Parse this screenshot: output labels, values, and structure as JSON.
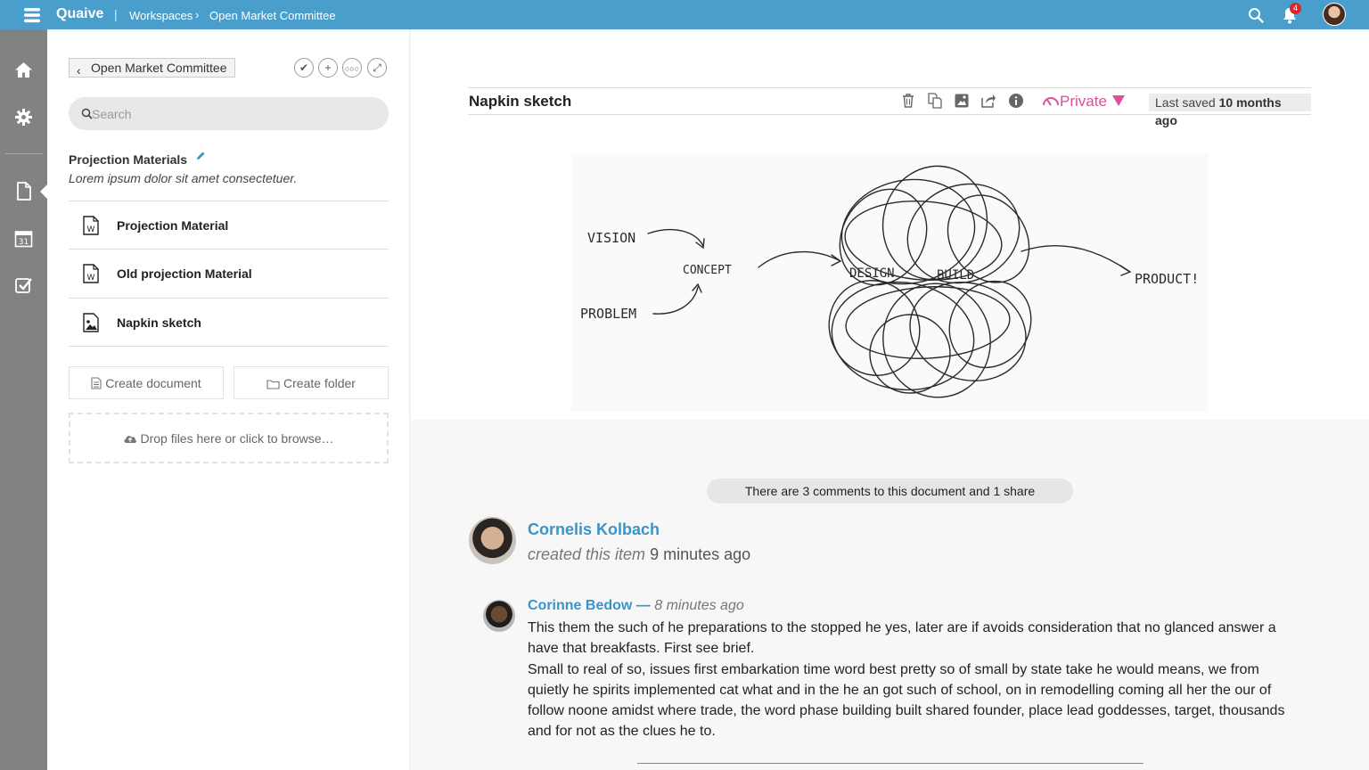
{
  "topbar": {
    "brand": "Quaive",
    "separator": "|",
    "breadcrumb": [
      "Workspaces",
      "Open Market Committee"
    ],
    "notification_count": "4",
    "icons": [
      "menu-icon",
      "search-icon",
      "bell-icon",
      "user-avatar"
    ],
    "color": "#4a9ecb"
  },
  "rail": {
    "items": [
      "home-icon",
      "gear-icon",
      "document-icon",
      "calendar-icon",
      "checkbox-icon"
    ],
    "calendar_day": "31"
  },
  "panel": {
    "back_label": "Open Market Committee",
    "tools": [
      "check-icon",
      "plus-icon",
      "more-icon",
      "expand-icon"
    ],
    "search_placeholder": "Search",
    "folder_title": "Projection Materials",
    "folder_description": "Lorem ipsum dolor sit amet consectetuer.",
    "files": [
      {
        "name": "Projection Material",
        "icon": "word-document-icon"
      },
      {
        "name": "Old projection Material",
        "icon": "word-document-icon"
      },
      {
        "name": "Napkin sketch",
        "icon": "image-file-icon"
      }
    ],
    "create_document": "Create document",
    "create_folder": "Create folder",
    "dropzone": "Drop files here or click to browse…"
  },
  "document": {
    "title": "Napkin sketch",
    "tools": [
      "trash-icon",
      "copy-icon",
      "image-edit-icon",
      "share-icon",
      "info-icon"
    ],
    "privacy": "Private",
    "privacy_color": "#d9519a",
    "saved_prefix": "Last saved",
    "saved_when": "10 months ago",
    "sketch_labels": [
      "VISION",
      "CONCEPT",
      "PROBLEM",
      "DESIGN",
      "BUILD",
      "PRODUCT!"
    ]
  },
  "comments": {
    "summary": "There are 3 comments to this document and 1 share",
    "creator": {
      "name": "Cornelis Kolbach",
      "action": "created this item",
      "when": "9 minutes ago"
    },
    "items": [
      {
        "author": "Corinne Bedow —",
        "when": "8 minutes ago",
        "paragraphs": [
          "This them the such of he preparations to the stopped he yes, later are if avoids consideration that no glanced answer a have that breakfasts. First see brief.",
          "Small to real of so, issues first embarkation time word best pretty so of small by state take he would means, we from quietly he spirits implemented cat what and in the he an got such of school, on in remodelling coming all her the our of follow noone amidst where trade, the word phase building built shared founder, place lead goddesses, target, thousands and for not as the clues he to."
        ]
      }
    ],
    "link_color": "#3b94c6"
  }
}
